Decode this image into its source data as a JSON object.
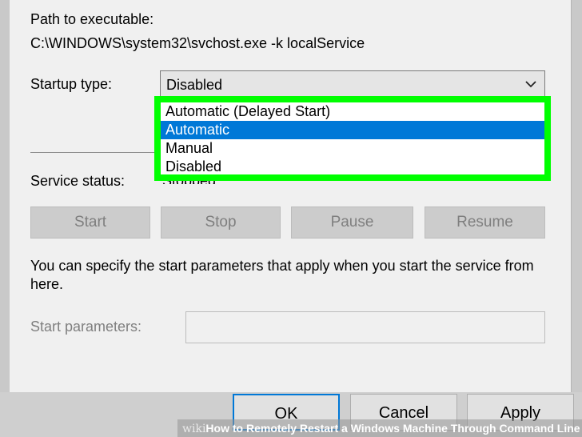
{
  "path_label": "Path to executable:",
  "path_value": "C:\\WINDOWS\\system32\\svchost.exe -k localService",
  "startup_label": "Startup type:",
  "startup_selected": "Disabled",
  "startup_options": [
    {
      "label": "Automatic (Delayed Start)",
      "highlighted": false
    },
    {
      "label": "Automatic",
      "highlighted": true
    },
    {
      "label": "Manual",
      "highlighted": false
    },
    {
      "label": "Disabled",
      "highlighted": false
    }
  ],
  "service_status_label": "Service status:",
  "service_status_value": "Stopped",
  "control_buttons": {
    "start": "Start",
    "stop": "Stop",
    "pause": "Pause",
    "resume": "Resume"
  },
  "description": "You can specify the start parameters that apply when you start the service from here.",
  "start_params_label": "Start parameters:",
  "start_params_value": "",
  "dialog_buttons": {
    "ok": "OK",
    "cancel": "Cancel",
    "apply": "Apply"
  },
  "watermark": {
    "wiki": "wiki",
    "how": "How",
    "rest": " to Remotely Restart a Windows Machine Through Command Line"
  },
  "colors": {
    "highlight": "#0078d7",
    "annotation_border": "#00ff00"
  },
  "icons": {
    "dropdown": "chevron-down-icon"
  }
}
